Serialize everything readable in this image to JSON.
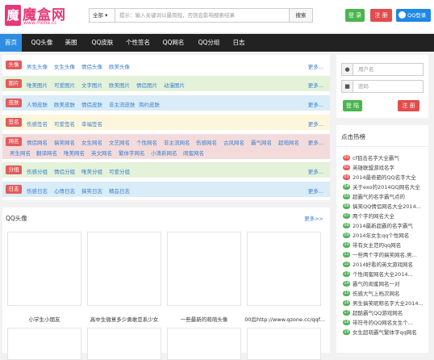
{
  "header": {
    "logo_char": "魔",
    "logo_title": "魔盒网",
    "logo_url": "www.mohe.cc",
    "search_scope": "全部",
    "search_placeholder": "提示：输入关键词以最简短，否则会影响搜索结果",
    "search_button": "搜索",
    "login_button": "登 录",
    "register_button": "注 册",
    "qq_login": "QQ登录",
    "colors": {
      "login": "#49b64d",
      "register": "#e34c4c",
      "qq": "#1e88e5",
      "brand": "#e8387a"
    }
  },
  "nav": [
    "首页",
    "QQ头像",
    "美图",
    "QQ皮肤",
    "个性签名",
    "QQ网名",
    "QQ分组",
    "日志"
  ],
  "categories": [
    {
      "tag": "头像",
      "color": "#e35b5b",
      "bg": "#ffffff",
      "links": [
        "男生头像",
        "女生头像",
        "情侣头像",
        "欧美头像"
      ],
      "more": "更多..."
    },
    {
      "tag": "图片",
      "color": "#e35b5b",
      "bg": "#e3f2d9",
      "links": [
        "唯美图片",
        "可爱图片",
        "文字图片",
        "欧美图片",
        "情侣图片",
        "动漫图片"
      ],
      "more": "更多..."
    },
    {
      "tag": "皮肤",
      "color": "#e35b5b",
      "bg": "#d9ecf7",
      "links": [
        "人物皮肤",
        "欧美皮肤",
        "情侣皮肤",
        "非主流皮肤",
        "简约皮肤"
      ],
      "more": "更多..."
    },
    {
      "tag": "签名",
      "color": "#e35b5b",
      "bg": "#fcf6dc",
      "links": [
        "伤感签名",
        "可爱签名",
        "幸福签名"
      ],
      "more": "更多..."
    },
    {
      "tag": "网名",
      "color": "#e35b5b",
      "bg": "#f3dbdb",
      "links": [
        "情侣网名",
        "搞笑网名",
        "女生网名",
        "文艺网名",
        "个性网名",
        "非主流网名",
        "伤感网名",
        "古风网名",
        "霸气网名",
        "超萌网名",
        "男生网名",
        "翻译网名",
        "唯美网名",
        "英文网名",
        "繁体字网名",
        "小清新网名",
        "闺蜜网名"
      ],
      "more": "更多..."
    },
    {
      "tag": "分组",
      "color": "#e35b5b",
      "bg": "#e3f2d9",
      "links": [
        "伤感分组",
        "情侣分组",
        "唯美分组",
        "可爱分组"
      ],
      "more": "更多..."
    },
    {
      "tag": "日志",
      "color": "#e35b5b",
      "bg": "#d9ecf7",
      "links": [
        "伤感日志",
        "心情日志",
        "搞笑日志",
        "精品日志"
      ],
      "more": "更多..."
    }
  ],
  "qq_section": {
    "title": "QQ头像",
    "more": "更多>>",
    "items": [
      "小学生小朋友",
      "高中生微意多少勇敢恋系少女",
      "一些最新的萌萌头像",
      "00后http://www.qzone.cc/qqf..."
    ]
  },
  "login_box": {
    "username_placeholder": "用户名",
    "password_placeholder": "密码",
    "login_button": "登 陆",
    "register_button": "注 册"
  },
  "hot": {
    "title": "点击热榜",
    "items": [
      {
        "num": "01",
        "text": "cf狙击名字大全霸气"
      },
      {
        "num": "02",
        "text": "英雄联盟游戏名字"
      },
      {
        "num": "03",
        "text": "2014最奇葩的QQ名字大全"
      },
      {
        "num": "04",
        "text": "关于exo的2014QQ网名大全"
      },
      {
        "num": "05",
        "text": "超霸气的名字霸气点的"
      },
      {
        "num": "06",
        "text": "搞笑QQ情侣网名大全2014..."
      },
      {
        "num": "07",
        "text": "两个字的网名大全"
      },
      {
        "num": "08",
        "text": "2014最新超霸的名字霸气"
      },
      {
        "num": "09",
        "text": "2014年女生qq个性网名"
      },
      {
        "num": "10",
        "text": "带有女主范的qq网名"
      },
      {
        "num": "11",
        "text": "一些两个字的搞笑网名,男..."
      },
      {
        "num": "12",
        "text": "2014好看的英文游戏网名"
      },
      {
        "num": "13",
        "text": "个性闺蜜网名大全2014..."
      },
      {
        "num": "14",
        "text": "霸气的闺蜜网名一对"
      },
      {
        "num": "15",
        "text": "伤感大气上档次网名"
      },
      {
        "num": "16",
        "text": "男生搞笑昵称名字大全2014..."
      },
      {
        "num": "17",
        "text": "超酷霸气QQ游戏网名"
      },
      {
        "num": "18",
        "text": "带符号的QQ网名女生个..."
      },
      {
        "num": "19",
        "text": "女生超萌霸气繁体字qq网名"
      }
    ]
  }
}
